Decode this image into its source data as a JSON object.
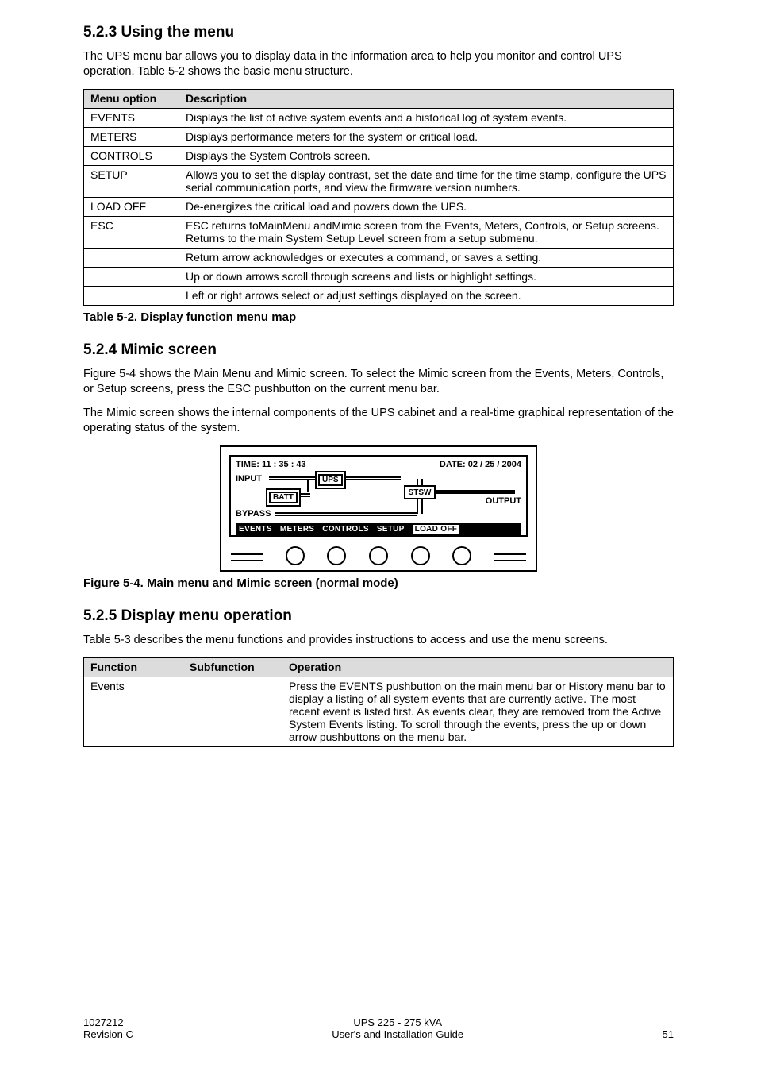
{
  "section523": {
    "heading": "5.2.3 Using the menu",
    "para": "The UPS menu bar allows you to display data in the information area to help you monitor and control UPS operation. Table 5-2 shows the basic menu structure."
  },
  "table52": {
    "headers": [
      "Menu option",
      "Description"
    ],
    "rows": [
      [
        "EVENTS",
        "Displays the list of active system events and a historical log of system events."
      ],
      [
        "METERS",
        "Displays performance meters for the system or critical load."
      ],
      [
        "CONTROLS",
        "Displays the System Controls screen."
      ],
      [
        "SETUP",
        "Allows you to set the display contrast, set the date and time for the time stamp, configure the UPS serial communication ports, and view the firmware version numbers."
      ],
      [
        "LOAD OFF",
        "De-energizes the critical load and powers down the UPS."
      ],
      [
        "ESC",
        "ESC returns toMainMenu andMimic screen from the Events, Meters, Controls, or Setup screens. Returns to the main System Setup Level screen from a setup submenu."
      ],
      [
        "",
        "Return arrow acknowledges or executes a command, or saves a setting."
      ],
      [
        "",
        "Up or down arrows scroll through screens and lists or highlight settings."
      ],
      [
        "",
        "Left or right arrows select or adjust settings displayed on the screen."
      ]
    ],
    "caption": "Table 5-2. Display function menu map"
  },
  "section524": {
    "heading": "5.2.4 Mimic screen",
    "para1": "Figure 5-4 shows the Main Menu and Mimic screen. To select the Mimic screen from the Events, Meters, Controls, or Setup screens, press the ESC pushbutton on the current menu bar.",
    "para2": "The Mimic screen shows the internal components of the UPS cabinet and a real-time graphical representation of the operating status of the system."
  },
  "mimic": {
    "time_label": "TIME:  11 : 35 : 43",
    "date_label": "DATE:  02 / 25 / 2004",
    "input": "INPUT",
    "ups": "UPS",
    "batt": "BATT",
    "stsw": "STSW",
    "output": "OUTPUT",
    "bypass": "BYPASS",
    "menu": [
      "EVENTS",
      "METERS",
      "CONTROLS",
      "SETUP",
      "LOAD OFF"
    ]
  },
  "fig54_caption": "Figure 5-4. Main menu and Mimic screen (normal mode)",
  "section525": {
    "heading": "5.2.5 Display menu operation",
    "para": "Table 5-3 describes the menu functions and provides instructions to access and use the menu screens."
  },
  "table53": {
    "headers": [
      "Function",
      "Subfunction",
      "Operation"
    ],
    "rows": [
      [
        "Events",
        "",
        "Press the EVENTS pushbutton on the main menu bar or History menu bar to display a listing of all system events that are currently active. The most recent event is listed first. As events clear, they are removed from the Active System Events listing. To scroll through the events, press the up or down arrow pushbuttons on the menu bar."
      ]
    ]
  },
  "footer": {
    "left1": "1027212",
    "left2": "Revision C",
    "center1": "UPS 225 - 275 kVA",
    "center2": "User's and Installation Guide",
    "right": "51"
  }
}
